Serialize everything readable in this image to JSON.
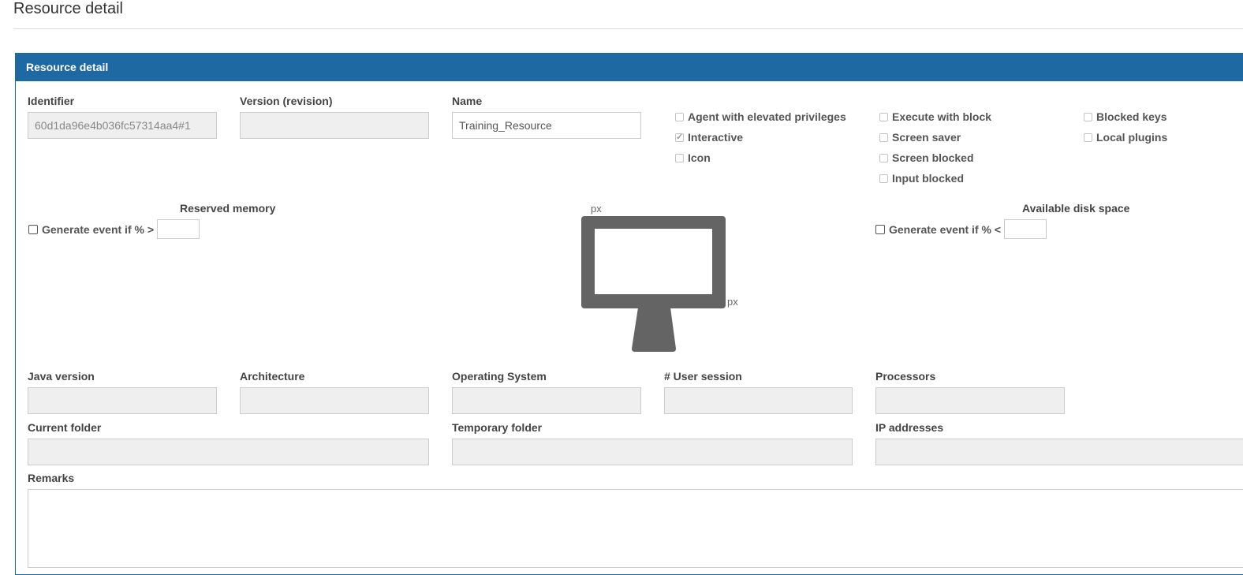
{
  "page": {
    "title": "Resource detail"
  },
  "panel": {
    "title": "Resource detail"
  },
  "fields": {
    "identifier": {
      "label": "Identifier",
      "value": "60d1da96e4b036fc57314aa4#1"
    },
    "version": {
      "label": "Version (revision)",
      "value": ""
    },
    "name": {
      "label": "Name",
      "value": "Training_Resource"
    },
    "java_version": {
      "label": "Java version",
      "value": ""
    },
    "architecture": {
      "label": "Architecture",
      "value": ""
    },
    "operating_system": {
      "label": "Operating System",
      "value": ""
    },
    "user_session": {
      "label": "# User session",
      "value": ""
    },
    "processors": {
      "label": "Processors",
      "value": ""
    },
    "current_folder": {
      "label": "Current folder",
      "value": ""
    },
    "temporary_folder": {
      "label": "Temporary folder",
      "value": ""
    },
    "ip_addresses": {
      "label": "IP addresses",
      "value": ""
    },
    "remarks": {
      "label": "Remarks",
      "value": ""
    }
  },
  "checkboxes": [
    {
      "label": "Agent with elevated privileges",
      "checked": false
    },
    {
      "label": "Interactive",
      "checked": true
    },
    {
      "label": "Icon",
      "checked": false
    },
    {
      "label": "Execute with block",
      "checked": false
    },
    {
      "label": "Screen saver",
      "checked": false
    },
    {
      "label": "Screen blocked",
      "checked": false
    },
    {
      "label": "Input blocked",
      "checked": false
    },
    {
      "label": "Blocked keys",
      "checked": false
    },
    {
      "label": "Local plugins",
      "checked": false
    }
  ],
  "memory": {
    "title": "Reserved memory",
    "event_label": "Generate event if % >"
  },
  "disk": {
    "title": "Available disk space",
    "event_label": "Generate event if % <"
  },
  "screen": {
    "width_unit": "px",
    "height_unit": "px"
  },
  "icons": {
    "monitor": "monitor-icon"
  },
  "colors": {
    "header": "#1f69a3",
    "monitor": "#646464"
  }
}
